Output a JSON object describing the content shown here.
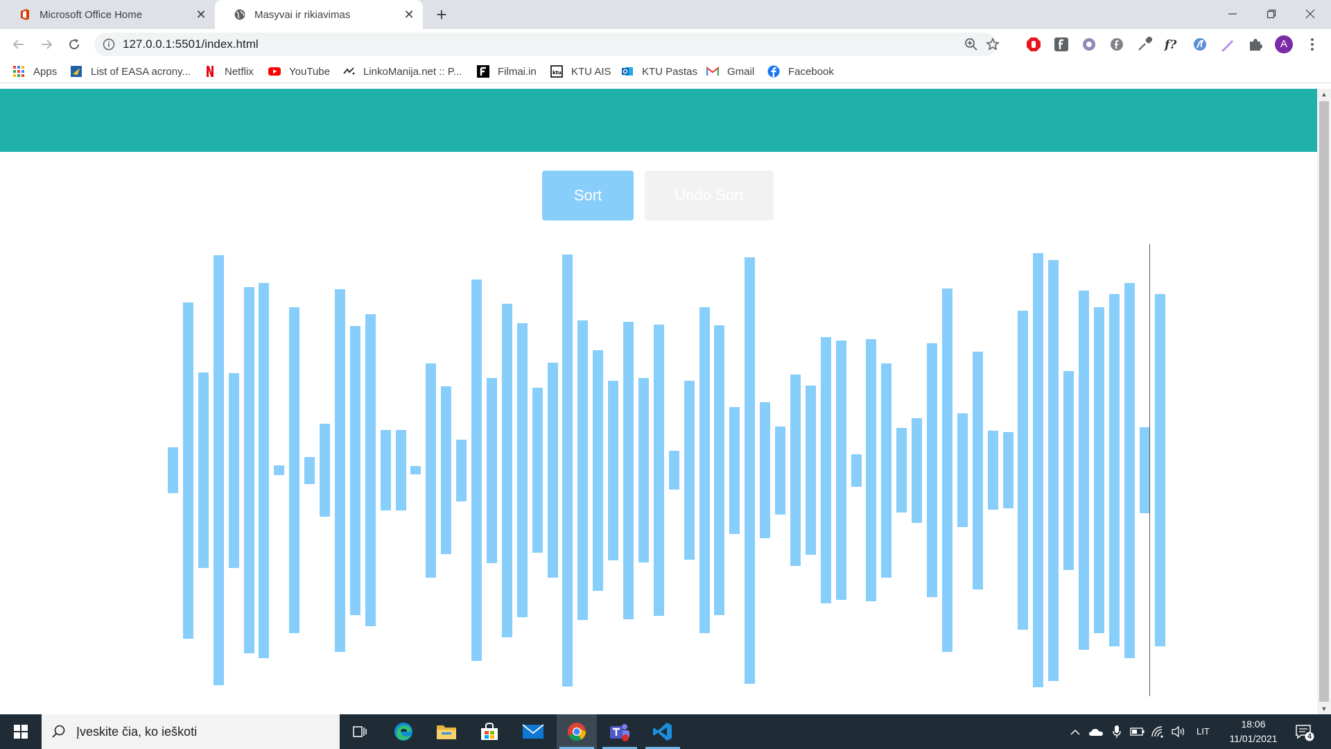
{
  "browser": {
    "tabs": [
      {
        "title": "Microsoft Office Home",
        "icon": "office-icon",
        "active": false
      },
      {
        "title": "Masyvai ir rikiavimas",
        "icon": "globe-icon",
        "active": true
      }
    ],
    "address": "127.0.0.1:5501/index.html",
    "profile_initial": "A",
    "bookmarks": [
      {
        "label": "Apps",
        "icon": "apps-grid-icon"
      },
      {
        "label": "List of EASA acrony...",
        "icon": "easa-icon"
      },
      {
        "label": "Netflix",
        "icon": "netflix-icon"
      },
      {
        "label": "YouTube",
        "icon": "youtube-icon"
      },
      {
        "label": "LinkoManija.net :: P...",
        "icon": "linkomanija-icon"
      },
      {
        "label": "Filmai.in",
        "icon": "filmai-icon"
      },
      {
        "label": "KTU AIS",
        "icon": "ktu-ais-icon"
      },
      {
        "label": "KTU Pastas",
        "icon": "outlook-icon"
      },
      {
        "label": "Gmail",
        "icon": "gmail-icon"
      },
      {
        "label": "Facebook",
        "icon": "facebook-icon"
      }
    ]
  },
  "page": {
    "sort_label": "Sort",
    "undo_label": "Undo Sort",
    "colors": {
      "header": "#20b2aa",
      "bar": "#87cefa",
      "sort_button": "#87cefa",
      "undo_button": "#f2f2f2",
      "undo_text": "#ffffff"
    },
    "bar_values": [
      66,
      485,
      282,
      620,
      281,
      528,
      541,
      14,
      470,
      39,
      134,
      523,
      417,
      450,
      116,
      116,
      12,
      309,
      242,
      89,
      550,
      267,
      481,
      424,
      238,
      310,
      623,
      432,
      347,
      259,
      429,
      266,
      420,
      56,
      258,
      470,
      418,
      183,
      615,
      196,
      127,
      276,
      244,
      384,
      374,
      47,
      378,
      309,
      122,
      151,
      366,
      524,
      164,
      343,
      114,
      110,
      460,
      626,
      607,
      287,
      518,
      470,
      508,
      541,
      124,
      508
    ]
  },
  "taskbar": {
    "search_placeholder": "Įveskite čia, ko ieškoti",
    "apps": [
      "task-view-icon",
      "edge-icon",
      "file-explorer-icon",
      "store-icon",
      "mail-icon",
      "chrome-icon",
      "teams-icon",
      "vscode-icon"
    ],
    "language": "LIT",
    "time": "18:06",
    "date": "11/01/2021",
    "notification_count": "4"
  }
}
